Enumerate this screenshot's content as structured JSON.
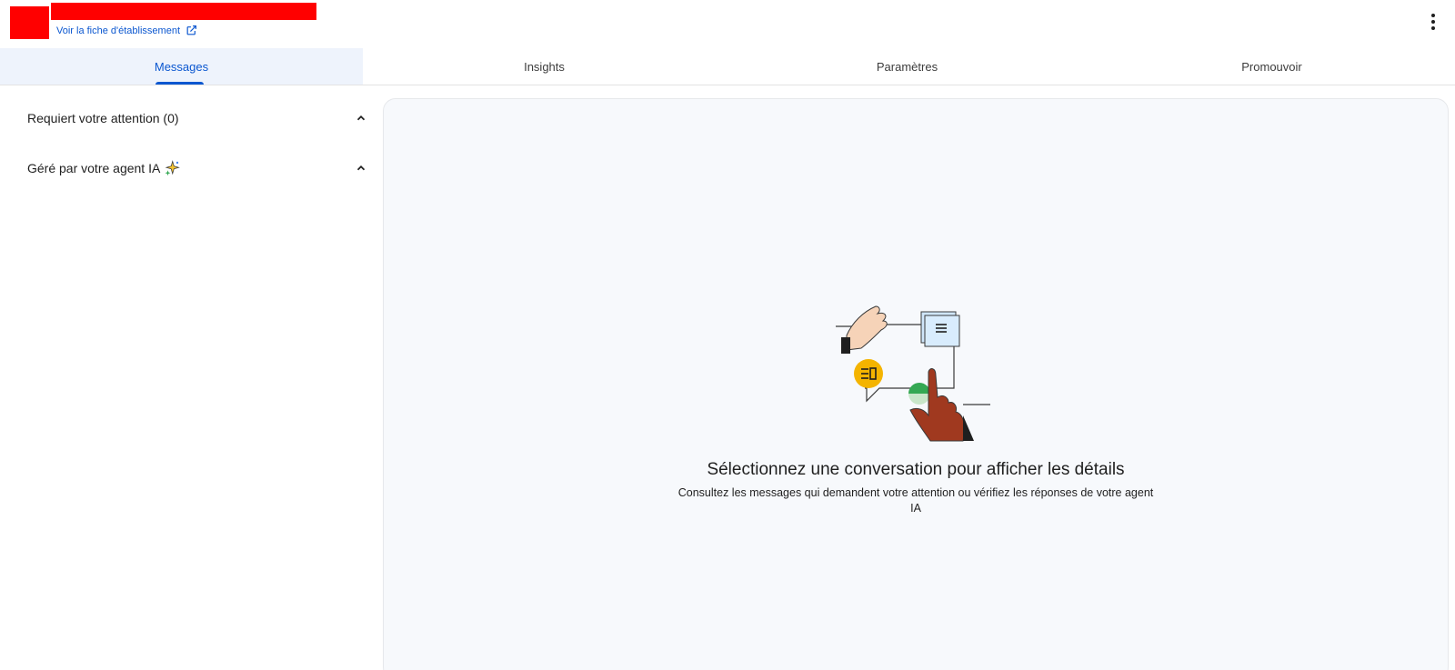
{
  "header": {
    "profile_link": "Voir la fiche d'établissement",
    "more_icon": "more-vert-icon",
    "external_icon": "open-in-new-icon"
  },
  "tabs": [
    {
      "label": "Messages",
      "active": true
    },
    {
      "label": "Insights",
      "active": false
    },
    {
      "label": "Paramètres",
      "active": false
    },
    {
      "label": "Promouvoir",
      "active": false
    }
  ],
  "sidebar": {
    "sections": [
      {
        "label": "Requiert votre attention (0)",
        "icon": "chevron-up-icon"
      },
      {
        "label": "Géré par votre agent IA",
        "icon": "chevron-up-icon",
        "badge_icon": "sparkle-icon"
      }
    ]
  },
  "main": {
    "empty_title": "Sélectionnez une conversation pour afficher les détails",
    "empty_subtitle": "Consultez les messages qui demandent votre attention ou vérifiez les réponses de votre agent IA"
  },
  "colors": {
    "accent": "#0b57d0",
    "tab_active_bg": "#eef3fc",
    "panel_bg": "#f7f9fc",
    "redaction": "#ff0000"
  }
}
